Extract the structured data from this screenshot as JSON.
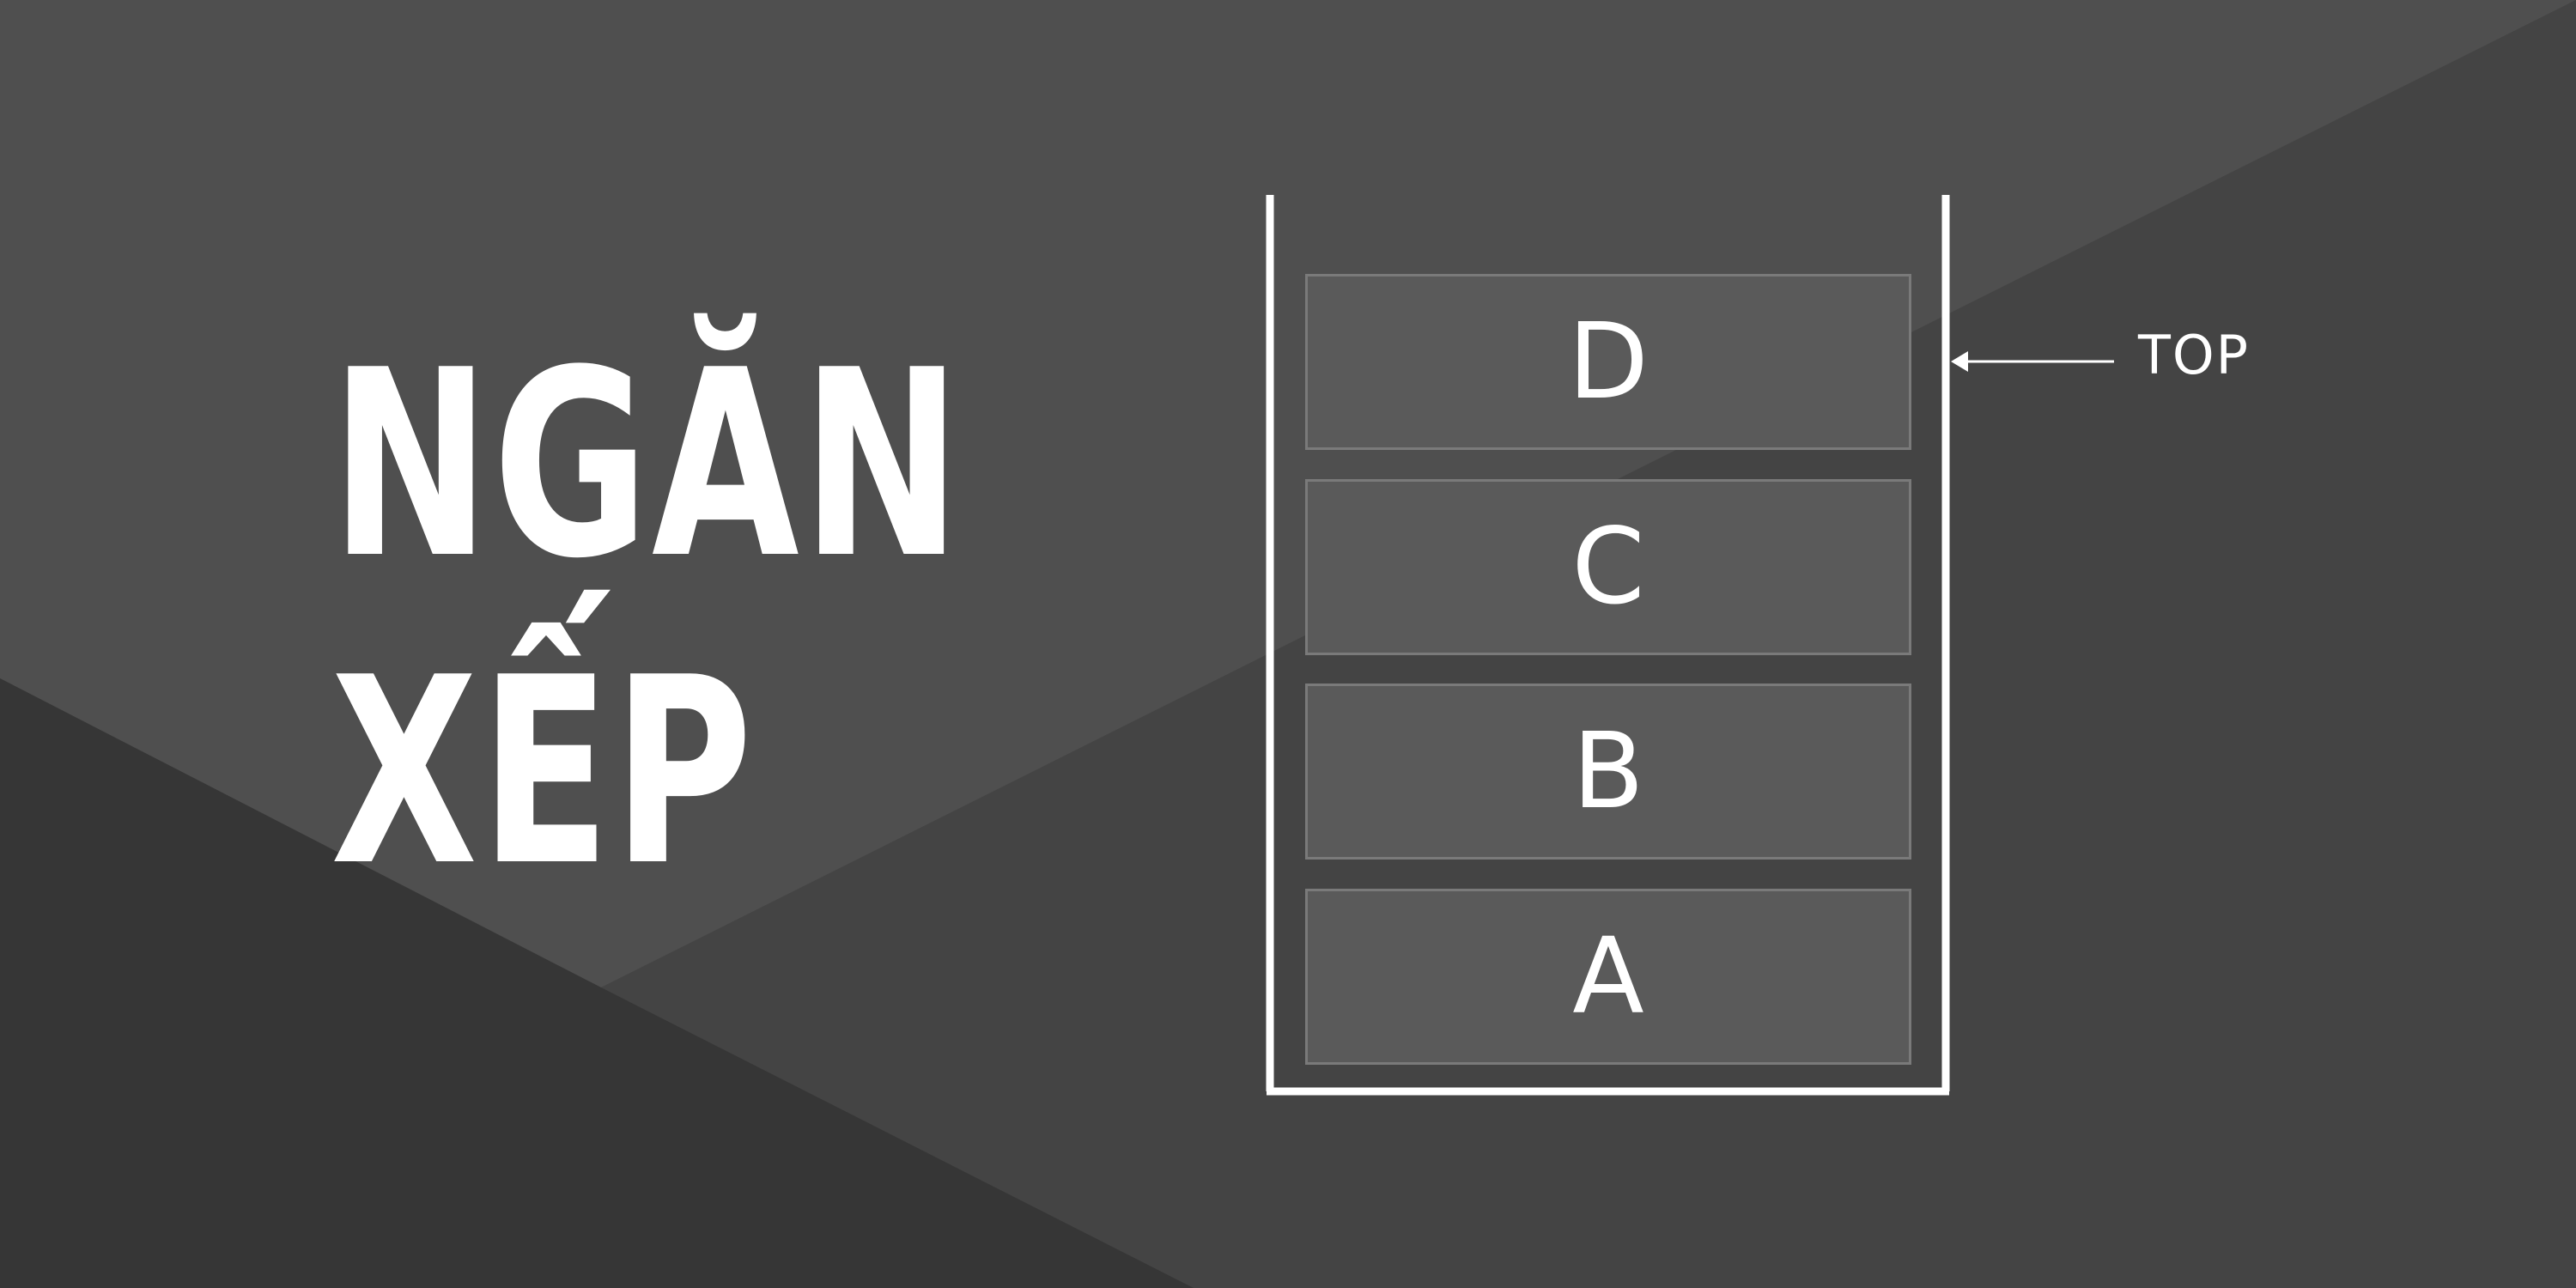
{
  "title": {
    "line1": "NGĂN",
    "line2": "XẾP"
  },
  "stack": {
    "items": [
      "A",
      "B",
      "C",
      "D"
    ],
    "top_label": "TOP"
  },
  "colors": {
    "background": "#454545",
    "foreground": "#ffffff",
    "item_fill": "#5a5a5a",
    "item_border": "#7a7a7a"
  }
}
